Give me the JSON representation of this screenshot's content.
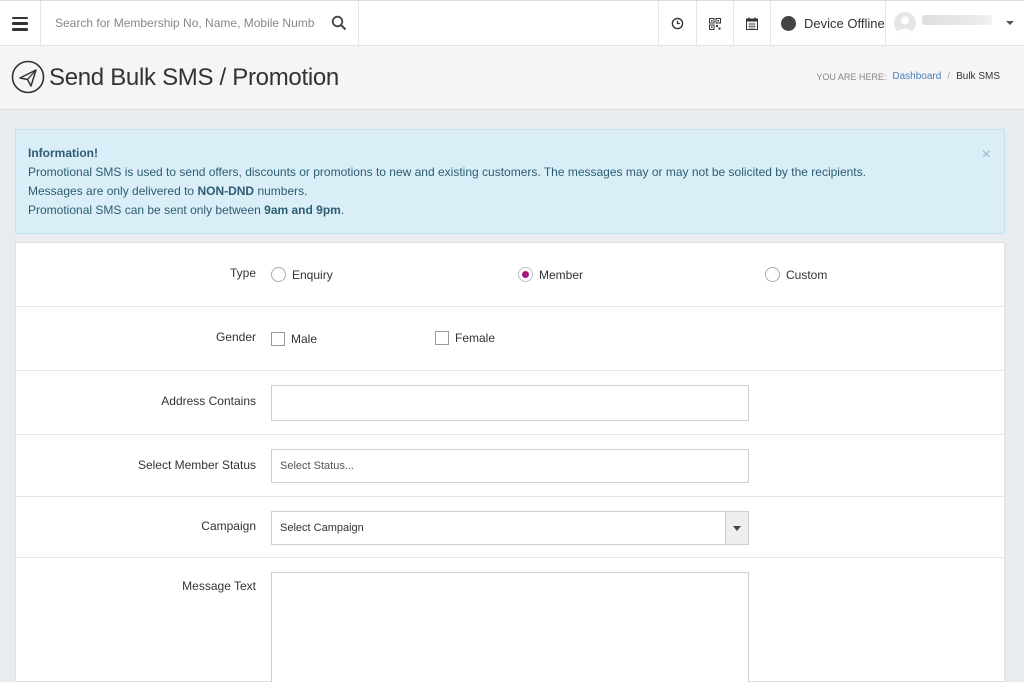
{
  "topbar": {
    "search_placeholder": "Search for Membership No, Name, Mobile Number",
    "device_status": "Device Offline",
    "icons": [
      "menu-icon",
      "search-icon",
      "clock-icon",
      "qr-code-icon",
      "calendar-icon",
      "status-dot-icon",
      "user-avatar-icon",
      "chevron-down-icon"
    ]
  },
  "page": {
    "title": "Send Bulk SMS / Promotion",
    "icon": "paper-plane-icon",
    "breadcrumb": {
      "label": "YOU ARE HERE:",
      "items": [
        "Dashboard",
        "Bulk SMS"
      ],
      "separator": "/"
    }
  },
  "alert": {
    "heading": "Information!",
    "line1": "Promotional SMS is used to send offers, discounts or promotions to new and existing customers. The messages may or may not be solicited by the recipients.",
    "line2_pre": "Messages are only delivered to ",
    "line2_bold": "NON-DND",
    "line2_post": " numbers.",
    "line3_pre": "Promotional SMS can be sent only between ",
    "line3_bold": "9am and 9pm",
    "line3_post": ".",
    "close": "×",
    "colors": {
      "background": "#d9eef6",
      "text": "#2d5d72"
    }
  },
  "form": {
    "type": {
      "label": "Type",
      "options": [
        "Enquiry",
        "Member",
        "Custom"
      ],
      "selected": "Member"
    },
    "gender": {
      "label": "Gender",
      "options": [
        "Male",
        "Female"
      ]
    },
    "address": {
      "label": "Address Contains",
      "value": ""
    },
    "member_status": {
      "label": "Select Member Status",
      "placeholder": "Select Status..."
    },
    "campaign": {
      "label": "Campaign",
      "value": "Select Campaign"
    },
    "message": {
      "label": "Message Text",
      "value": ""
    }
  },
  "colors": {
    "radio_selected": "#a4157a",
    "link": "#4a7fb5"
  }
}
